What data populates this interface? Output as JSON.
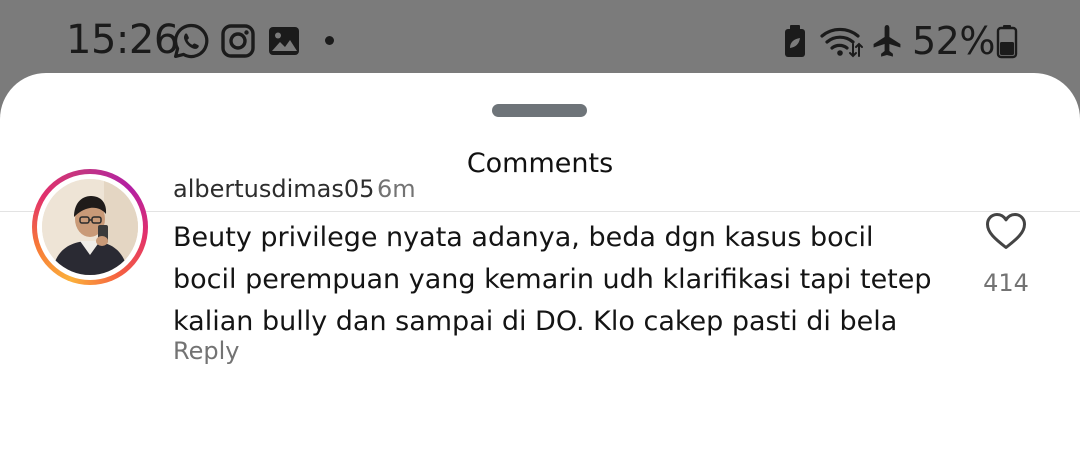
{
  "status_bar": {
    "time": "15:26",
    "battery_percent": "52%",
    "left_icons": [
      "whatsapp-icon",
      "instagram-icon",
      "gallery-icon"
    ],
    "right_icons": [
      "battery-saver-icon",
      "wifi-icon",
      "airplane-mode-icon",
      "battery-icon"
    ]
  },
  "sheet": {
    "title": "Comments"
  },
  "comment": {
    "username": "albertusdimas05",
    "time_ago": "6m",
    "text": "Beuty privilege nyata adanya, beda dgn kasus bocil bocil perempuan yang kemarin udh klarifikasi tapi tetep kalian bully dan sampai di DO. Klo cakep pasti di bela",
    "reply_label": "Reply",
    "like_count": "414"
  },
  "colors": {
    "background_dim": "#7b7b7b",
    "sheet": "#ffffff",
    "handle": "#6e7479",
    "secondary_text": "#737373",
    "story_ring": [
      "#fbb03b",
      "#e1306c",
      "#b31fa4"
    ]
  }
}
